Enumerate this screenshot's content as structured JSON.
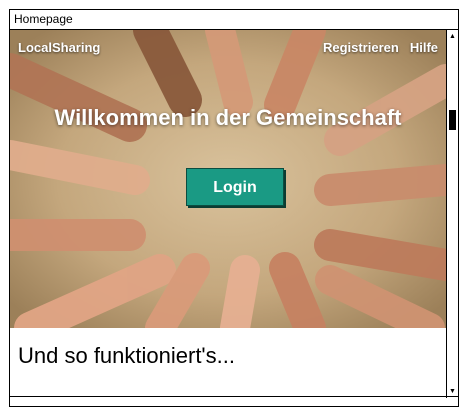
{
  "window": {
    "title": "Homepage"
  },
  "nav": {
    "brand": "LocalSharing",
    "links": [
      "Registrieren",
      "Hilfe"
    ]
  },
  "hero": {
    "title": "Willkommen in der Gemeinschaft",
    "login_label": "Login",
    "accent_color": "#1a9a84"
  },
  "section": {
    "title": "Und so funktioniert's..."
  },
  "scrollbar": {
    "up_icon": "▲",
    "down_icon": "▼"
  }
}
